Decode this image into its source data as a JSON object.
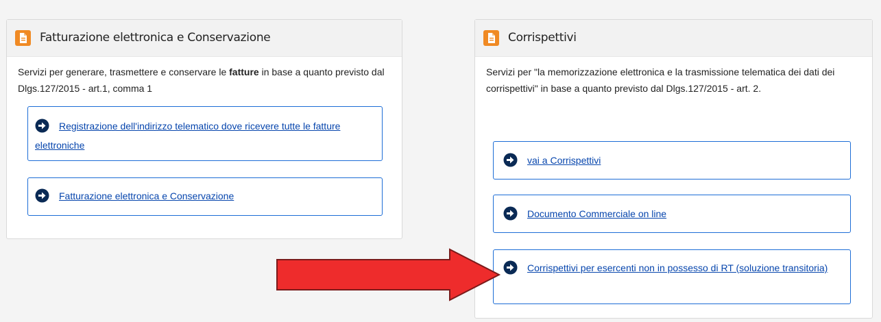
{
  "left_panel": {
    "title": "Fatturazione elettronica e Conservazione",
    "desc_part1": "Servizi per generare, trasmettere e conservare le ",
    "desc_bold": "fatture",
    "desc_part2": " in base a quanto previsto dal Dlgs.127/2015 - art.1, comma 1",
    "links": [
      {
        "label": "Registrazione dell'indirizzo telematico dove ricevere tutte le fatture elettroniche"
      },
      {
        "label": "Fatturazione elettronica e Conservazione"
      }
    ]
  },
  "right_panel": {
    "title": "Corrispettivi",
    "desc": "Servizi per \"la memorizzazione elettronica e la trasmissione telematica dei dati dei corrispettivi\" in base a quanto previsto dal Dlgs.127/2015 - art. 2.",
    "links": [
      {
        "label": "vai a Corrispettivi"
      },
      {
        "label": "Documento Commerciale on line"
      },
      {
        "label": "Corrispettivi per esercenti non in possesso di RT (soluzione transitoria)"
      }
    ]
  },
  "icons": {
    "header_icon": "document-icon",
    "link_icon": "circle-arrow-right-icon",
    "annotation": "red-arrow-icon"
  },
  "colors": {
    "accent_orange": "#f08a24",
    "link_blue": "#0645ad",
    "box_border_blue": "#1b6cd6",
    "annotation_red": "#ee2c2c"
  }
}
